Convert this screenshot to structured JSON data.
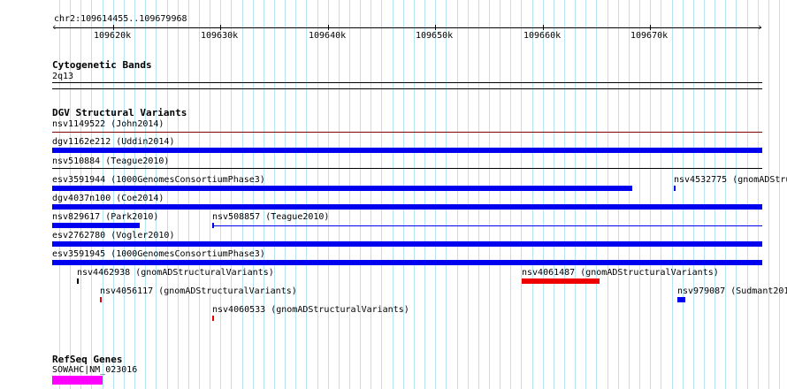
{
  "ruler": {
    "region_label": "chr2:109614455..109679968",
    "ticks": [
      "109620k",
      "109630k",
      "109640k",
      "109650k",
      "109660k",
      "109670k"
    ]
  },
  "cytobands": {
    "title": "Cytogenetic Bands",
    "band_label": "2q13"
  },
  "dgv": {
    "title": "DGV Structural Variants",
    "features": [
      {
        "label": "nsv1149522 (John2014)"
      },
      {
        "label": "dgv1162e212 (Uddin2014)"
      },
      {
        "label": "nsv510884 (Teague2010)"
      },
      {
        "label": "esv3591944 (1000GenomesConsortiumPhase3)"
      },
      {
        "label": "nsv4532775 (gnomADStru"
      },
      {
        "label": "dgv4037n100 (Coe2014)"
      },
      {
        "label": "nsv829617 (Park2010)"
      },
      {
        "label": "nsv508857 (Teague2010)"
      },
      {
        "label": "esv2762780 (Vogler2010)"
      },
      {
        "label": "esv3591945 (1000GenomesConsortiumPhase3)"
      },
      {
        "label": "nsv4462938 (gnomADStructuralVariants)"
      },
      {
        "label": "nsv4061487 (gnomADStructuralVariants)"
      },
      {
        "label": "nsv4056117 (gnomADStructuralVariants)"
      },
      {
        "label": "nsv979087 (Sudmant201"
      },
      {
        "label": "nsv4060533 (gnomADStructuralVariants)"
      }
    ]
  },
  "refseq": {
    "title": "RefSeq Genes",
    "gene_label": "SOWAHC|NM_023016"
  },
  "colors": {
    "gridline": "#b7e4f2",
    "gain_blue": "#0000ee",
    "loss_red": "#ee0000",
    "maroon_line": "#800000",
    "gene_magenta": "#ff00ff"
  }
}
